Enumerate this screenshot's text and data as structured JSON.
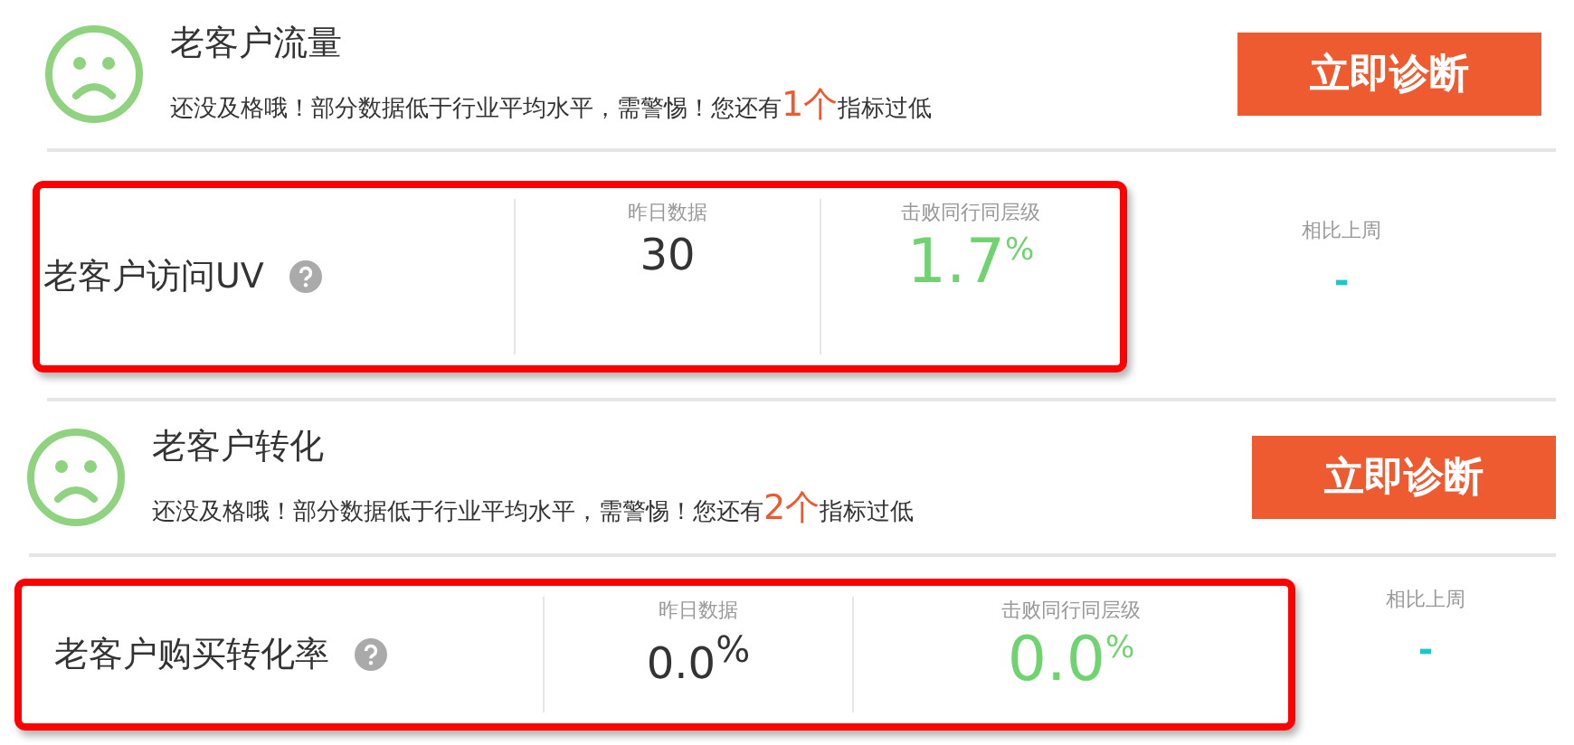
{
  "sections": [
    {
      "title": "老客户流量",
      "message": "还没及格哦！部分数据低于行业平均水平，需警惕！您还有**1个**指标过低",
      "button": "立即诊断",
      "metric": {
        "name": "老客户访问UV",
        "highlighted": true,
        "yesterday_label": "昨日数据",
        "yesterday": "30",
        "beat_label": "击败同行同层级",
        "beat": "1.7$^{%}$",
        "compare_label": "相比上周",
        "compare": "-"
      }
    },
    {
      "title": "老客户转化",
      "message": "还没及格哦！部分数据低于行业平均水平，需警惕！您还有**2个**指标过低",
      "button": "立即诊断",
      "metric": {
        "name": "老客户购买转化率",
        "highlighted": true,
        "yesterday_label": "昨日数据",
        "yesterday": "0.0$^{%}$",
        "beat_label": "击败同行同层级",
        "beat": "0.0$^{%}$",
        "compare_label": "相比上周",
        "compare": "-"
      }
    }
  ]
}
